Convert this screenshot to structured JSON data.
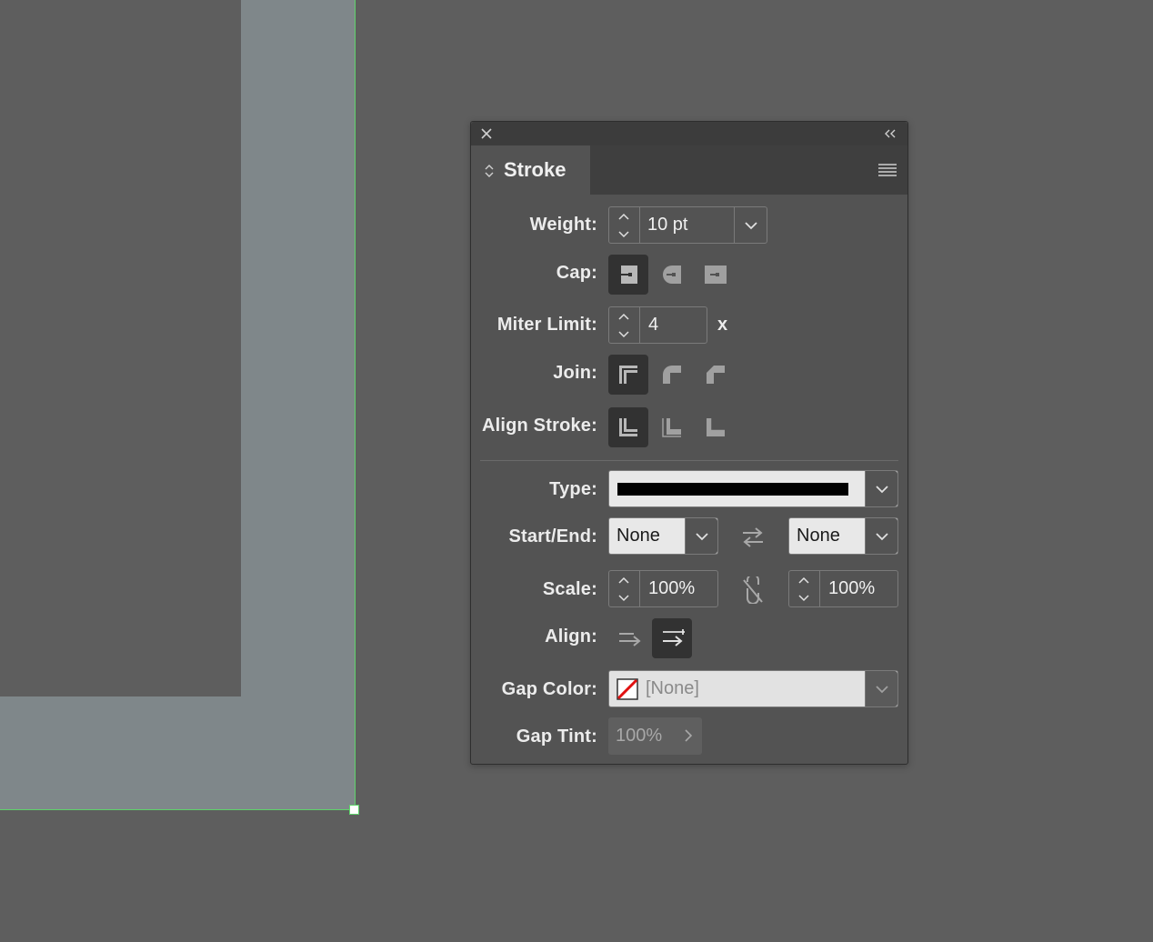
{
  "panel": {
    "tab_label": "Stroke",
    "weight": {
      "label": "Weight:",
      "value": "10 pt"
    },
    "cap": {
      "label": "Cap:"
    },
    "miter": {
      "label": "Miter Limit:",
      "value": "4",
      "suffix": "x"
    },
    "join": {
      "label": "Join:"
    },
    "align_stroke": {
      "label": "Align Stroke:"
    },
    "type": {
      "label": "Type:",
      "swatch_color": "#000000"
    },
    "start_end": {
      "label": "Start/End:",
      "start": "None",
      "end": "None"
    },
    "scale": {
      "label": "Scale:",
      "start": "100%",
      "end": "100%"
    },
    "align": {
      "label": "Align:"
    },
    "gap_color": {
      "label": "Gap Color:",
      "value": "[None]"
    },
    "gap_tint": {
      "label": "Gap Tint:",
      "value": "100%"
    }
  },
  "colors": {
    "canvas": "#5e5e5e",
    "frame": "#7f878a",
    "selection": "#5fd36b",
    "panel": "#535353"
  },
  "icons": [
    "close-icon",
    "collapse-icon",
    "panel-menu-icon",
    "swap-arrows-icon",
    "unlink-icon",
    "chevron-down-icon"
  ]
}
